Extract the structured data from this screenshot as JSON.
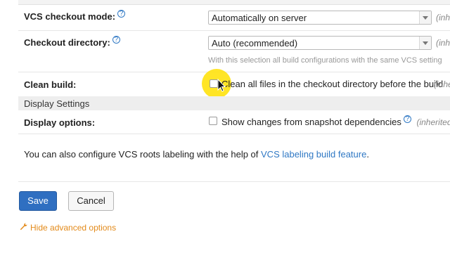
{
  "fields": {
    "vcs_mode_label": "VCS checkout mode:",
    "vcs_mode_value": "Automatically on server",
    "vcs_mode_inherited": "(inhe",
    "checkout_dir_label": "Checkout directory:",
    "checkout_dir_value": "Auto (recommended)",
    "checkout_dir_inherited": "(inhe",
    "checkout_dir_note": "With this selection all build configurations with the same VCS setting",
    "clean_build_label": "Clean build:",
    "clean_build_option": "Clean all files in the checkout directory before the build",
    "clean_build_inherited": "(inhe",
    "display_section": "Display Settings",
    "display_options_label": "Display options:",
    "display_option_text": "Show changes from snapshot dependencies",
    "display_option_inherited": "(inherited)"
  },
  "footnote": {
    "text": "You can also configure VCS roots labeling with the help of ",
    "link": "VCS labeling build feature",
    "end": "."
  },
  "buttons": {
    "save": "Save",
    "cancel": "Cancel"
  },
  "advanced_link": "Hide advanced options",
  "colors": {
    "link": "#2f78c4",
    "save_button": "#2f6fc1",
    "advanced_link": "#e38a1a",
    "highlight": "#ffe100"
  },
  "clean_build_checked": false,
  "display_option_checked": false
}
